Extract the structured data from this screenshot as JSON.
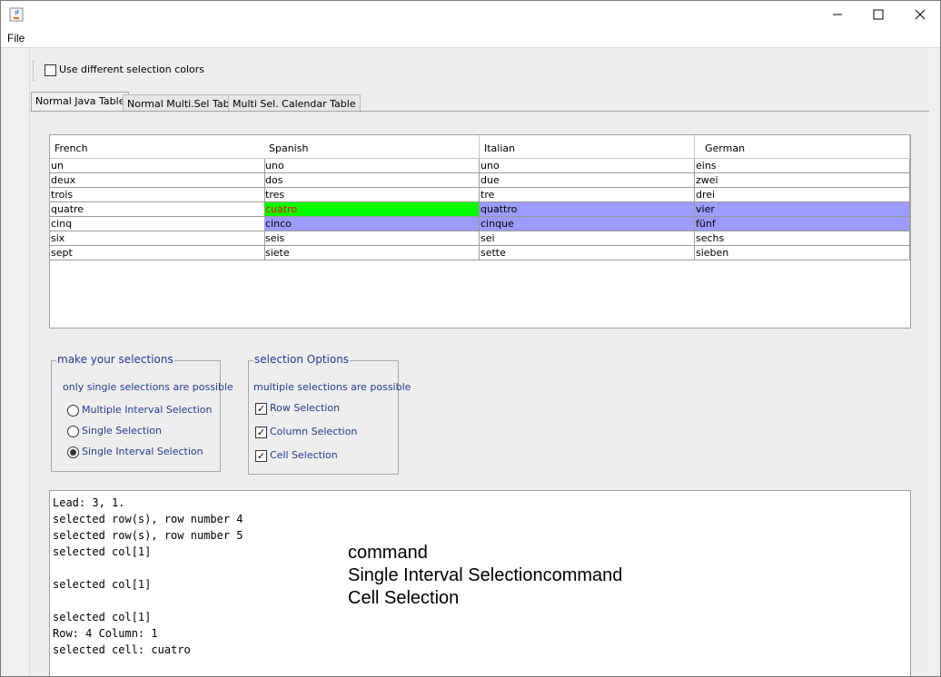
{
  "window": {
    "menu": {
      "file": "File"
    }
  },
  "toolbar": {
    "use_colors_label": "Use different selection colors",
    "use_colors_checked": false
  },
  "tabs": [
    {
      "label": "Normal Java Table",
      "active": true
    },
    {
      "label": "Normal Multi.Sel Table",
      "active": false
    },
    {
      "label": "Multi Sel. Calendar Table",
      "active": false
    }
  ],
  "table": {
    "columns": [
      "French",
      "Spanish",
      "Italian",
      "German"
    ],
    "rows": [
      [
        "un",
        "uno",
        "uno",
        "eins"
      ],
      [
        "deux",
        "dos",
        "due",
        "zwei"
      ],
      [
        "trois",
        "tres",
        "tre",
        "drei"
      ],
      [
        "quatre",
        "cuatro",
        "quattro",
        "vier"
      ],
      [
        "cinq",
        "cinco",
        "cinque",
        "fünf"
      ],
      [
        "six",
        "seis",
        "sei",
        "sechs"
      ],
      [
        "sept",
        "siete",
        "sette",
        "sieben"
      ]
    ],
    "selection_color": "#9c9cff",
    "lead_color": "#00ff00",
    "lead_text_color": "#ff0000"
  },
  "selection_mode": {
    "title": "make your selections",
    "hint": "only single selections are possible",
    "options": [
      {
        "label": "Multiple Interval Selection",
        "selected": false
      },
      {
        "label": "Single Selection",
        "selected": false
      },
      {
        "label": "Single Interval Selection",
        "selected": true
      }
    ]
  },
  "selection_options": {
    "title": "selection Options",
    "hint": "multiple selections are possible",
    "options": [
      {
        "label": "Row Selection",
        "checked": true
      },
      {
        "label": "Column Selection",
        "checked": true
      },
      {
        "label": "Cell Selection",
        "checked": true
      }
    ]
  },
  "log": {
    "text": "Lead: 3, 1.\nselected row(s), row number 4\nselected row(s), row number 5\nselected col[1]\n\nselected col[1]\n\nselected col[1]\nRow: 4 Column: 1\nselected cell: cuatro",
    "overlay": "command\nSingle Interval Selectioncommand\nCell Selection"
  },
  "accent_color": "#203c8f"
}
